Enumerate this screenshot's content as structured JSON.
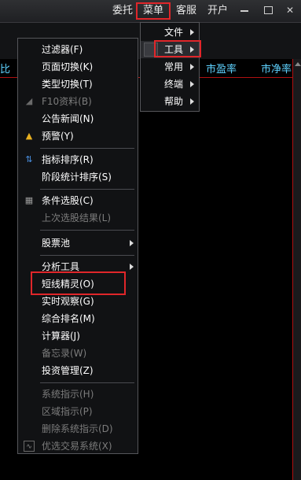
{
  "topbar": {
    "weituo": "委托",
    "caidan": "菜单",
    "kefu": "客服",
    "kaihu": "开户"
  },
  "columns": {
    "bi": "比",
    "pe": "市盈率",
    "pb": "市净率"
  },
  "submenu": [
    {
      "label": "文件"
    },
    {
      "label": "工具"
    },
    {
      "label": "常用"
    },
    {
      "label": "终端"
    },
    {
      "label": "帮助"
    }
  ],
  "menu": {
    "items": [
      {
        "label": "过滤器(F)"
      },
      {
        "label": "页面切换(K)"
      },
      {
        "label": "类型切换(T)"
      },
      {
        "label": "F10资料(B)"
      },
      {
        "label": "公告新闻(N)"
      },
      {
        "label": "预警(Y)"
      },
      {
        "label": "指标排序(R)"
      },
      {
        "label": "阶段统计排序(S)"
      },
      {
        "label": "条件选股(C)"
      },
      {
        "label": "上次选股结果(L)"
      },
      {
        "label": "股票池"
      },
      {
        "label": "分析工具"
      },
      {
        "label": "短线精灵(O)"
      },
      {
        "label": "实时观察(G)"
      },
      {
        "label": "综合排名(M)"
      },
      {
        "label": "计算器(J)"
      },
      {
        "label": "备忘录(W)"
      },
      {
        "label": "投资管理(Z)"
      },
      {
        "label": "系统指示(H)"
      },
      {
        "label": "区域指示(P)"
      },
      {
        "label": "删除系统指示(D)"
      },
      {
        "label": "优选交易系统(X)"
      }
    ]
  },
  "colors": {
    "highlight": "#e0262a",
    "column_header": "#5fd2ff",
    "disabled_text": "#7c7c7c"
  }
}
